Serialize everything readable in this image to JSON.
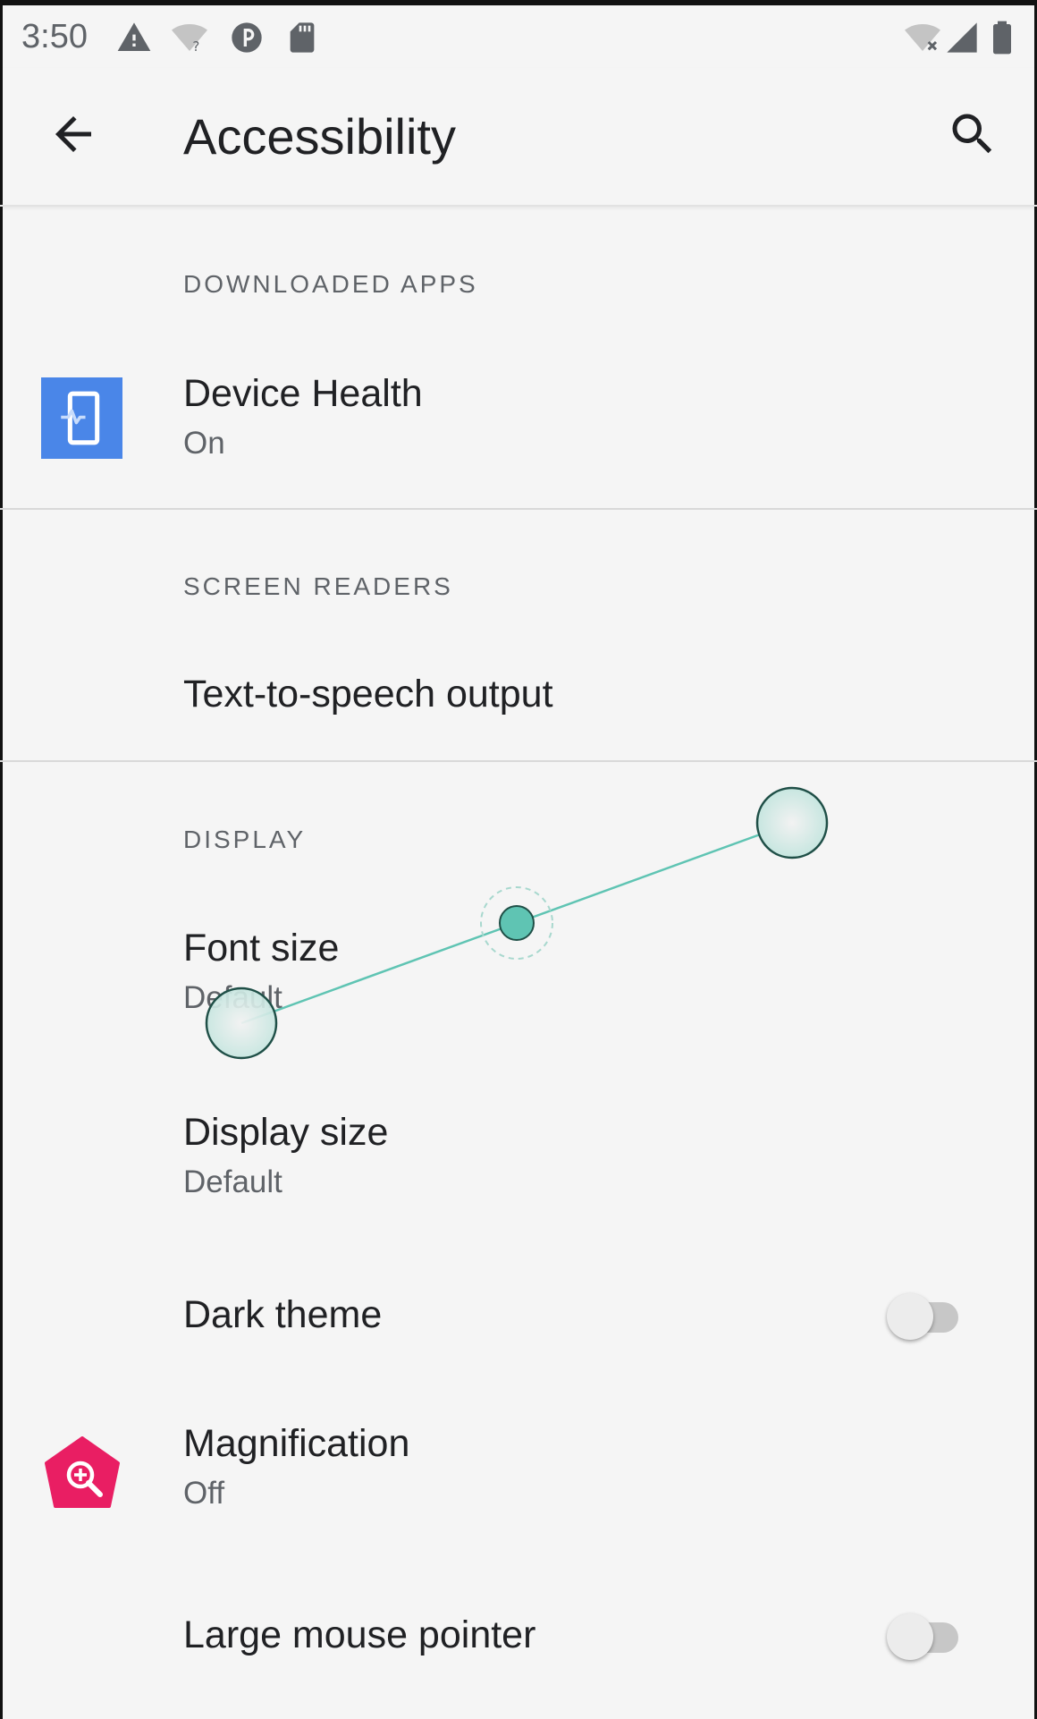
{
  "status_bar": {
    "time": "3:50",
    "icons": [
      "alert-icon",
      "wifi-unknown-icon",
      "data-saver-icon",
      "sd-card-icon",
      "wifi-off-icon",
      "cell-signal-icon",
      "battery-icon"
    ]
  },
  "app_bar": {
    "title": "Accessibility",
    "back_icon": "arrow-back-icon",
    "search_icon": "search-icon"
  },
  "sections": {
    "downloaded_apps": {
      "header": "DOWNLOADED APPS",
      "items": [
        {
          "title": "Device Health",
          "summary": "On",
          "icon": "device-health-icon",
          "icon_color": "#4a86e8"
        }
      ]
    },
    "screen_readers": {
      "header": "SCREEN READERS",
      "items": [
        {
          "title": "Text-to-speech output"
        }
      ]
    },
    "display": {
      "header": "DISPLAY",
      "items": [
        {
          "title": "Font size",
          "summary": "Default"
        },
        {
          "title": "Display size",
          "summary": "Default"
        },
        {
          "title": "Dark theme",
          "toggle": false
        },
        {
          "title": "Magnification",
          "summary": "Off",
          "icon": "magnification-icon",
          "icon_color": "#e91e63"
        },
        {
          "title": "Large mouse pointer",
          "toggle": false
        }
      ]
    }
  },
  "colors": {
    "background": "#f5f5f5",
    "gesture_accent": "#5fc4b3"
  }
}
